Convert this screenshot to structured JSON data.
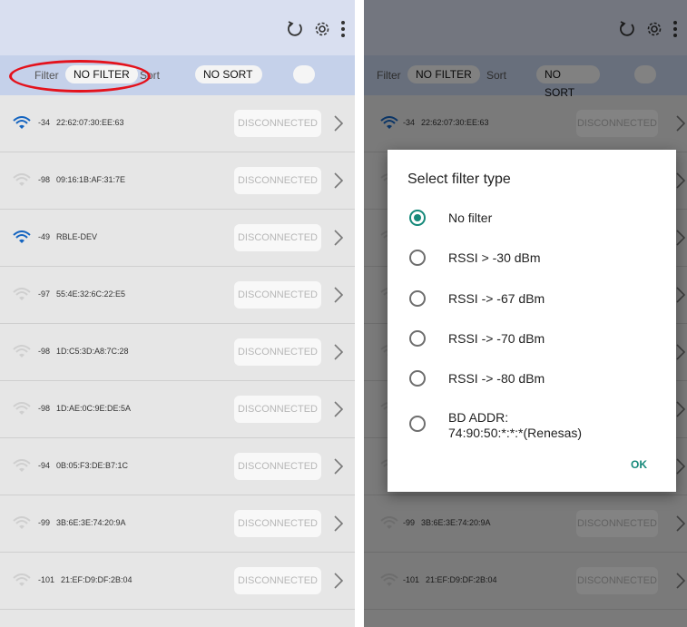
{
  "left": {
    "toolbar": {
      "icons": [
        "refresh-icon",
        "settings-icon",
        "more-vert-icon"
      ]
    },
    "filter_label": "Filter",
    "filter_value": "NO FILTER",
    "sort_label": "Sort",
    "sort_value": "NO SORT",
    "devices": [
      {
        "rssi": "-34",
        "name": "22:62:07:30:EE:63",
        "status": "DISCONNECTED",
        "signal": "strong"
      },
      {
        "rssi": "-98",
        "name": "09:16:1B:AF:31:7E",
        "status": "DISCONNECTED",
        "signal": "weak"
      },
      {
        "rssi": "-49",
        "name": "RBLE-DEV",
        "status": "DISCONNECTED",
        "signal": "strong"
      },
      {
        "rssi": "-97",
        "name": "55:4E:32:6C:22:E5",
        "status": "DISCONNECTED",
        "signal": "weak"
      },
      {
        "rssi": "-98",
        "name": "1D:C5:3D:A8:7C:28",
        "status": "DISCONNECTED",
        "signal": "weak"
      },
      {
        "rssi": "-98",
        "name": "1D:AE:0C:9E:DE:5A",
        "status": "DISCONNECTED",
        "signal": "weak"
      },
      {
        "rssi": "-94",
        "name": "0B:05:F3:DE:B7:1C",
        "status": "DISCONNECTED",
        "signal": "weak"
      },
      {
        "rssi": "-99",
        "name": "3B:6E:3E:74:20:9A",
        "status": "DISCONNECTED",
        "signal": "weak"
      },
      {
        "rssi": "-101",
        "name": "21:EF:D9:DF:2B:04",
        "status": "DISCONNECTED",
        "signal": "weak"
      }
    ]
  },
  "right": {
    "filter_label": "Filter",
    "filter_value": "NO FILTER",
    "sort_label": "Sort",
    "sort_value": "NO SORT",
    "devices": [
      {
        "rssi": "-34",
        "name": "22:62:07:30:EE:63",
        "status": "DISCONNECTED"
      },
      {
        "rssi": "",
        "name": "",
        "status": ""
      },
      {
        "rssi": "",
        "name": "",
        "status": ""
      },
      {
        "rssi": "",
        "name": "",
        "status": ""
      },
      {
        "rssi": "",
        "name": "",
        "status": ""
      },
      {
        "rssi": "",
        "name": "",
        "status": ""
      },
      {
        "rssi": "",
        "name": "",
        "status": ""
      },
      {
        "rssi": "-99",
        "name": "3B:6E:3E:74:20:9A",
        "status": "DISCONNECTED"
      },
      {
        "rssi": "-101",
        "name": "21:EF:D9:DF:2B:04",
        "status": "DISCONNECTED"
      }
    ],
    "dialog": {
      "title": "Select filter type",
      "options": [
        {
          "label": "No filter",
          "selected": true
        },
        {
          "label": "RSSI > -30 dBm",
          "selected": false
        },
        {
          "label": "RSSI -> -67 dBm",
          "selected": false
        },
        {
          "label": "RSSI -> -70 dBm",
          "selected": false
        },
        {
          "label": "RSSI -> -80 dBm",
          "selected": false
        },
        {
          "label": "BD ADDR:\n74:90:50:*:*:*(Renesas)",
          "selected": false
        }
      ],
      "ok_label": "OK"
    }
  },
  "colors": {
    "accent": "#16897a",
    "appbar": "#d9dff0",
    "filterbar": "#c5d1ea",
    "wifi_strong": "#1565c0",
    "annotation": "#e4121c"
  }
}
